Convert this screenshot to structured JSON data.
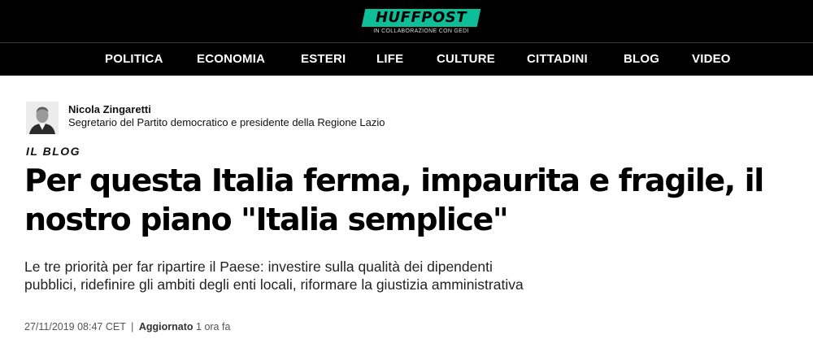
{
  "brand": {
    "logo_text": "HUFFPOST",
    "logo_subtitle": "IN COLLABORAZIONE CON GEDI",
    "accent_color": "#0dbe98"
  },
  "nav": {
    "items": [
      "POLITICA",
      "ECONOMIA",
      "ESTERI",
      "LIFE",
      "CULTURE",
      "CITTADINI",
      "BLOG",
      "VIDEO"
    ]
  },
  "author": {
    "name": "Nicola Zingaretti",
    "role": "Segretario del Partito democratico e presidente della Regione Lazio",
    "avatar_icon": "author-photo"
  },
  "article": {
    "section": "IL BLOG",
    "headline": "Per questa Italia ferma, impaurita e fragile, il nostro piano \"Italia semplice\"",
    "subtitle": "Le tre priorità per far ripartire il Paese: investire sulla qualità dei dipendenti pubblici, ridefinire gli ambiti degli enti locali, riformare la giustizia amministrativa",
    "published": "27/11/2019 08:47 CET",
    "separator": "|",
    "updated_label": "Aggiornato",
    "updated_value": "1 ora fa"
  }
}
